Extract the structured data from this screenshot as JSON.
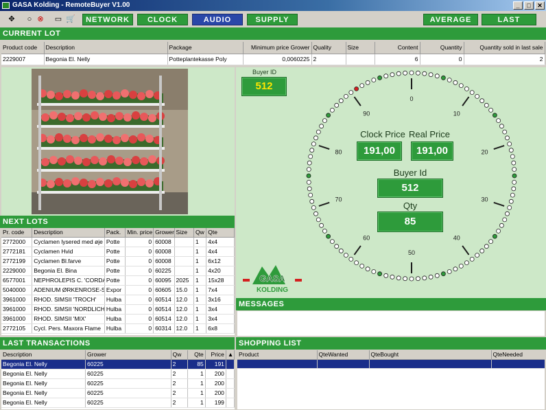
{
  "window": {
    "title": "GASA Kolding - RemoteBuyer V1.00",
    "btn_min": "_",
    "btn_max": "□",
    "btn_close": "✕"
  },
  "toolbar": {
    "network": "NETWORK",
    "clock": "CLOCK",
    "audio": "AUDIO",
    "supply": "SUPPLY",
    "average": "AVERAGE",
    "last": "LAST",
    "icons": {
      "a": "✥",
      "b": "○",
      "c": "⊗",
      "d": "▭",
      "e": "🛒"
    }
  },
  "current_lot": {
    "title": "CURRENT LOT",
    "headers": [
      "Product code",
      "Description",
      "Package",
      "Minimum price Grower",
      "Quality",
      "Size",
      "Content",
      "Quantity",
      "Quantity sold in last sale"
    ],
    "row": [
      "2229007",
      "Begonia El. Nelly",
      "Potteplantekasse Poly",
      "0,0060225",
      "2",
      "",
      "6",
      "0",
      "2"
    ]
  },
  "next_lots": {
    "title": "NEXT LOTS",
    "headers": [
      "Pr. code",
      "Description",
      "Pack.",
      "Min. price",
      "Grower",
      "Size",
      "Qw",
      "Qte"
    ],
    "rows": [
      [
        "2772000",
        "Cyclamen lysered med øje",
        "Potte",
        "0",
        "60008",
        "",
        "1",
        "4x4"
      ],
      [
        "2772181",
        "Cyclamen Hvid",
        "Potte",
        "0",
        "60008",
        "",
        "1",
        "4x4"
      ],
      [
        "2772199",
        "Cyclamen Bl.farve",
        "Potte",
        "0",
        "60008",
        "",
        "1",
        "6x12"
      ],
      [
        "2229000",
        "Begonia El. Bina",
        "Potte",
        "0",
        "60225",
        "",
        "1",
        "4x20"
      ],
      [
        "6577001",
        "NEPHROLEPIS C. 'CORDA",
        "Potte",
        "0",
        "60095",
        "2025",
        "1",
        "15x28"
      ],
      [
        "5040000",
        "ADENIUM ØRKENROSE-S",
        "Expor",
        "0",
        "60605",
        "15.0",
        "1",
        "7x4"
      ],
      [
        "3961000",
        "RHOD. SIMSII 'TROCH'",
        "Hulba",
        "0",
        "60514",
        "12.0",
        "1",
        "3x16"
      ],
      [
        "3961000",
        "RHOD. SIMSII 'NORDLICH",
        "Hulba",
        "0",
        "60514",
        "12.0",
        "1",
        "3x4"
      ],
      [
        "3961000",
        "RHOD. SIMSII 'MIX'",
        "Hulba",
        "0",
        "60514",
        "12.0",
        "1",
        "3x4"
      ],
      [
        "2772105",
        "Cycl. Pers. Maxora Flame",
        "Hulba",
        "0",
        "60314",
        "12.0",
        "1",
        "6x8"
      ]
    ]
  },
  "last_transactions": {
    "title": "LAST TRANSACTIONS",
    "headers": [
      "Description",
      "Grower",
      "Qw",
      "Qte",
      "Price"
    ],
    "rows": [
      [
        "Begonia El. Nelly",
        "60225",
        "2",
        "85",
        "191"
      ],
      [
        "Begonia El. Nelly",
        "60225",
        "2",
        "1",
        "200"
      ],
      [
        "Begonia El. Nelly",
        "60225",
        "2",
        "1",
        "200"
      ],
      [
        "Begonia El. Nelly",
        "60225",
        "2",
        "1",
        "200"
      ],
      [
        "Begonia El. Nelly",
        "60225",
        "2",
        "1",
        "199"
      ]
    ]
  },
  "clock": {
    "buyer_id_label": "Buyer ID",
    "buyer_id_value": "512",
    "clock_price_label": "Clock Price",
    "clock_price_value": "191,00",
    "real_price_label": "Real Price",
    "real_price_value": "191,00",
    "buyer_id2_label": "Buyer Id",
    "buyer_id2_value": "512",
    "qty_label": "Qty",
    "qty_value": "85",
    "dial_numbers": [
      "0",
      "10",
      "20",
      "30",
      "40",
      "50",
      "60",
      "70",
      "80",
      "90"
    ],
    "colors": {
      "dot_green": "#2e9b3b",
      "dot_red": "#d42020",
      "tick": "#1a1a1a"
    }
  },
  "logo": {
    "text": "GASA",
    "subtext": "KOLDING"
  },
  "messages": {
    "title": "MESSAGES"
  },
  "shopping_list": {
    "title": "SHOPPING LIST",
    "headers": [
      "Product",
      "QteWanted",
      "QteBought",
      "QteNeeded"
    ]
  }
}
